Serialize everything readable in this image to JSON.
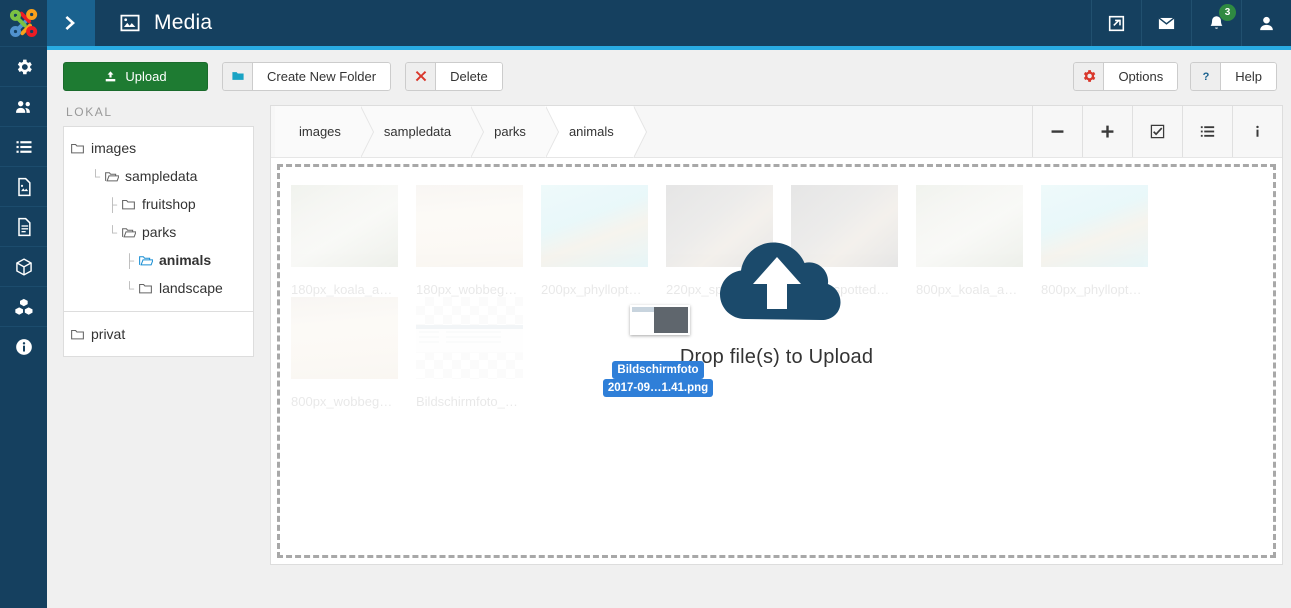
{
  "header": {
    "title": "Media",
    "title_icon": "image-icon",
    "toggle_icon": "chevron-right-icon",
    "actions": [
      {
        "name": "quick-link-icon",
        "icon": "external-link-icon",
        "badge": null
      },
      {
        "name": "messages-icon",
        "icon": "envelope-icon",
        "badge": null
      },
      {
        "name": "notifications-icon",
        "icon": "bell-icon",
        "badge": "3"
      },
      {
        "name": "user-menu-icon",
        "icon": "user-icon",
        "badge": null
      }
    ],
    "accent_color": "#29abe2",
    "bg_color": "#15405f",
    "toggle_bg_color": "#1a628f"
  },
  "rail": {
    "logo": "joomla-logo",
    "items": [
      {
        "name": "system-icon",
        "icon": "gear"
      },
      {
        "name": "users-icon",
        "icon": "users"
      },
      {
        "name": "menus-icon",
        "icon": "list"
      },
      {
        "name": "content-media-icon",
        "icon": "image-file"
      },
      {
        "name": "content-icon",
        "icon": "document"
      },
      {
        "name": "components-icon",
        "icon": "box"
      },
      {
        "name": "extensions-icon",
        "icon": "boxes"
      },
      {
        "name": "help-icon",
        "icon": "info-circle"
      }
    ]
  },
  "toolbar": {
    "upload_label": "Upload",
    "upload_icon": "upload-icon",
    "upload_color": "#1e7b32",
    "new_folder_label": "Create New Folder",
    "new_folder_icon": "folder-icon",
    "new_folder_icon_color": "#19a3c4",
    "delete_label": "Delete",
    "delete_icon": "times-icon",
    "delete_icon_color": "#d9372b",
    "options_label": "Options",
    "options_icon": "gear-icon",
    "options_icon_color": "#d9372b",
    "help_label": "Help",
    "help_icon": "question-icon",
    "help_icon_color": "#1a628f"
  },
  "tree": {
    "label": "LOKAL",
    "nodes": [
      {
        "label": "images",
        "depth": 1,
        "open": false,
        "selected": false,
        "guide": ""
      },
      {
        "label": "sampledata",
        "depth": 2,
        "open": true,
        "selected": false,
        "guide": "└"
      },
      {
        "label": "fruitshop",
        "depth": 3,
        "open": false,
        "selected": false,
        "guide": "├"
      },
      {
        "label": "parks",
        "depth": 3,
        "open": true,
        "selected": false,
        "guide": "└"
      },
      {
        "label": "animals",
        "depth": 4,
        "open": true,
        "selected": true,
        "guide": "├"
      },
      {
        "label": "landscape",
        "depth": 4,
        "open": false,
        "selected": false,
        "guide": "└"
      }
    ],
    "extra_nodes": [
      {
        "label": "privat",
        "depth": 1,
        "open": false,
        "selected": false,
        "guide": ""
      }
    ]
  },
  "breadcrumb": [
    {
      "label": "images",
      "active": false
    },
    {
      "label": "sampledata",
      "active": false
    },
    {
      "label": "parks",
      "active": false
    },
    {
      "label": "animals",
      "active": true
    }
  ],
  "view_buttons": [
    {
      "name": "zoom-out-button",
      "icon": "minus-icon"
    },
    {
      "name": "zoom-in-button",
      "icon": "plus-icon"
    },
    {
      "name": "select-all-button",
      "icon": "check-square-icon"
    },
    {
      "name": "list-view-button",
      "icon": "list-icon"
    },
    {
      "name": "info-button",
      "icon": "info-icon"
    }
  ],
  "files": [
    {
      "name": "180px_koala_a…",
      "kind": "koala"
    },
    {
      "name": "180px_wobbeg…",
      "kind": "wobbegong"
    },
    {
      "name": "200px_phyllopt…",
      "kind": "seadragon"
    },
    {
      "name": "220px_spotted",
      "kind": "quoll"
    },
    {
      "name": "789px_spotted…",
      "kind": "quoll"
    },
    {
      "name": "800px_koala_a…",
      "kind": "koala"
    },
    {
      "name": "800px_phyllopt…",
      "kind": "seadragon"
    },
    {
      "name": "800px_wobbeg…",
      "kind": "wobbegong"
    },
    {
      "name": "Bildschirmfoto_…",
      "kind": "screenshot"
    }
  ],
  "dropzone": {
    "message": "Drop file(s) to Upload",
    "cloud_icon": "cloud-upload-icon",
    "cloud_color": "#1b4a6b"
  },
  "drag_ghost": {
    "filename_line1": "Bildschirmfoto",
    "filename_line2": "2017-09…1.41.png",
    "highlight_color": "#2f7fd8"
  }
}
